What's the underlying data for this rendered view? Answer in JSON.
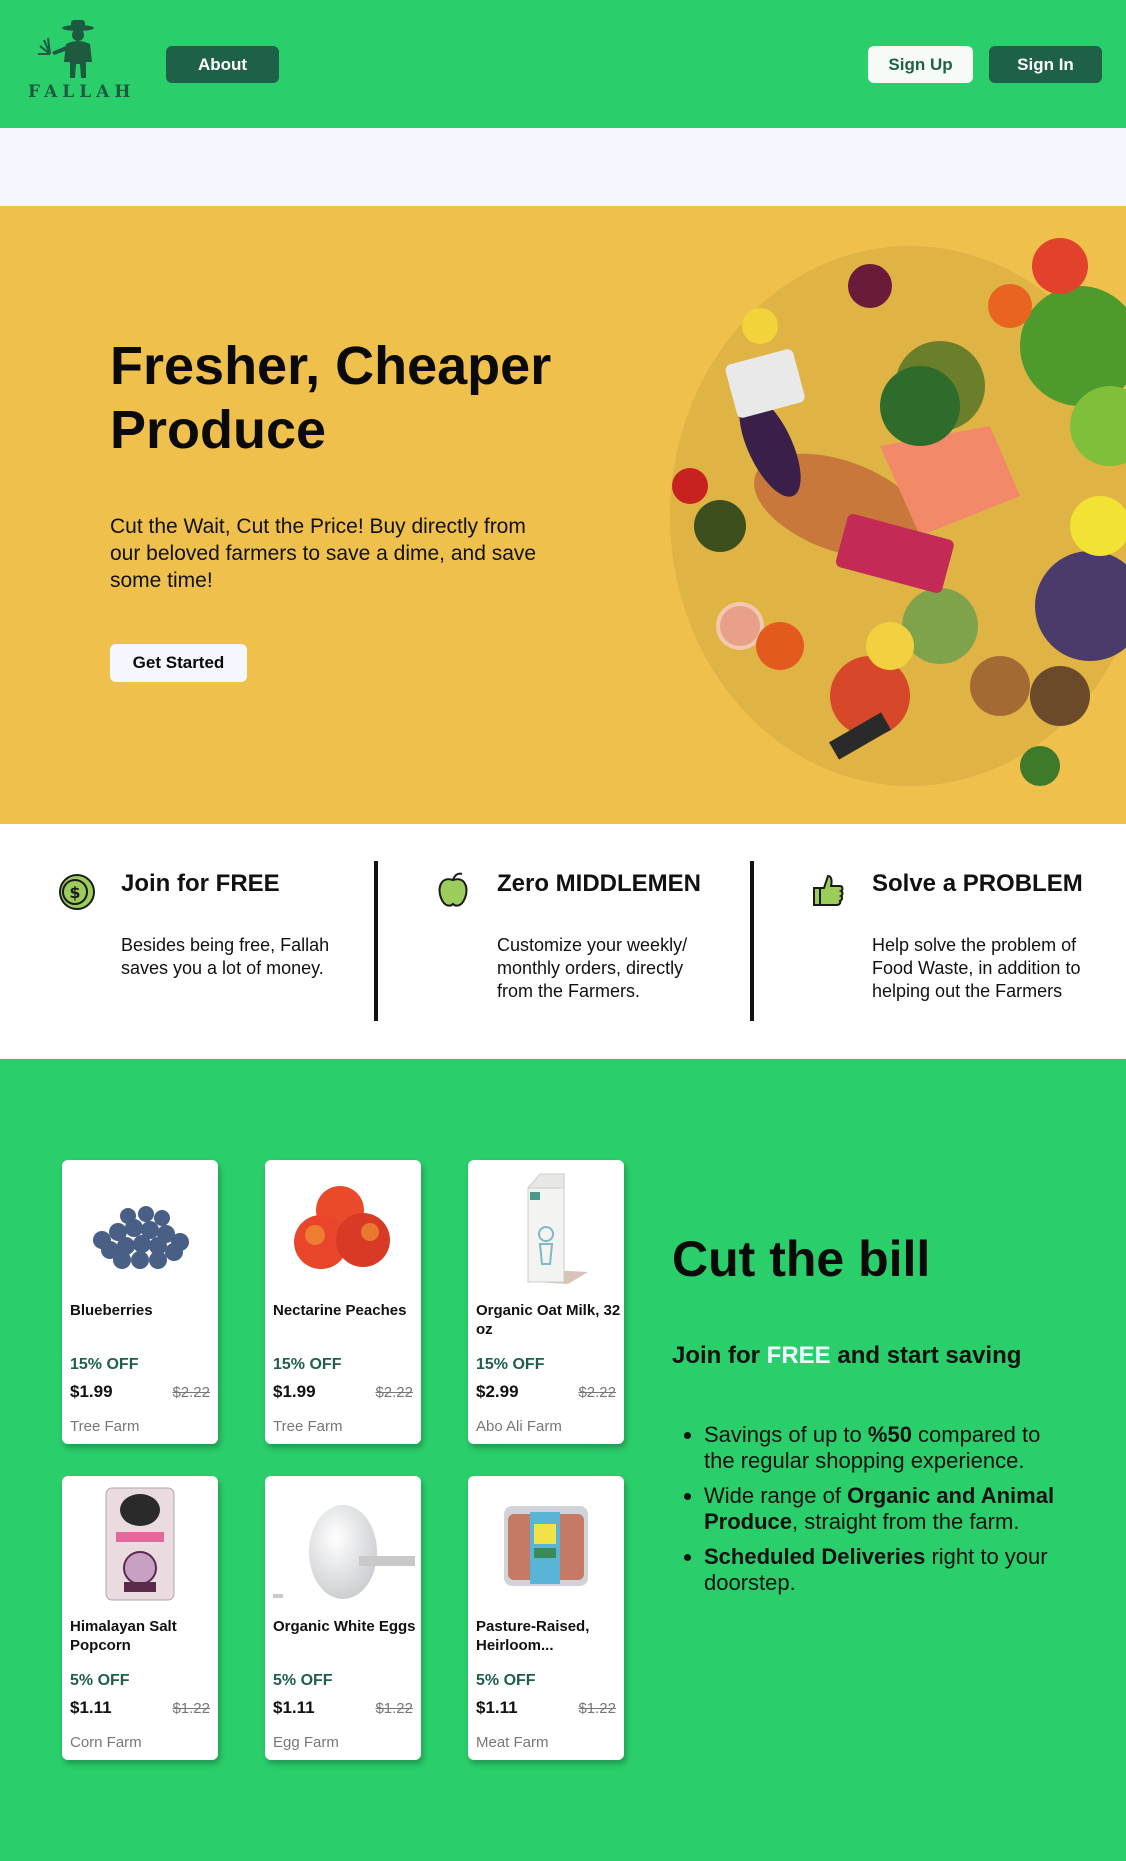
{
  "header": {
    "logo_text": "FALLAH",
    "about_label": "About",
    "signup_label": "Sign Up",
    "signin_label": "Sign In"
  },
  "hero": {
    "title": "Fresher, Cheaper Produce",
    "subtitle": "Cut the Wait, Cut the Price! Buy directly from our beloved farmers to save a dime, and save some time!",
    "cta_label": "Get Started"
  },
  "features": [
    {
      "icon": "dollar-coin-icon",
      "title": "Join for FREE",
      "text": "Besides being free, Fallah saves you a lot of money."
    },
    {
      "icon": "apple-icon",
      "title": "Zero MIDDLEMEN",
      "text": "Customize your weekly/ monthly orders, directly from the Farmers."
    },
    {
      "icon": "thumbs-up-icon",
      "title": "Solve a PROBLEM",
      "text": "Help solve the problem of Food Waste, in addition to helping out the Farmers"
    }
  ],
  "products": [
    {
      "name": "Blueberries",
      "discount": "15% OFF",
      "price": "$1.99",
      "old_price": "$2.22",
      "farm": "Tree Farm",
      "image": "blueberries"
    },
    {
      "name": "Nectarine Peaches",
      "discount": "15% OFF",
      "price": "$1.99",
      "old_price": "$2.22",
      "farm": "Tree Farm",
      "image": "peaches"
    },
    {
      "name": "Organic Oat Milk, 32 oz",
      "discount": "15% OFF",
      "price": "$2.99",
      "old_price": "$2.22",
      "farm": "Abo Ali Farm",
      "image": "oat-milk"
    },
    {
      "name": "Himalayan Salt Popcorn",
      "discount": "5% OFF",
      "price": "$1.11",
      "old_price": "$1.22",
      "farm": "Corn Farm",
      "image": "popcorn"
    },
    {
      "name": "Organic White Eggs",
      "discount": "5% OFF",
      "price": "$1.11",
      "old_price": "$1.22",
      "farm": "Egg Farm",
      "image": "egg"
    },
    {
      "name": "Pasture-Raised, Heirloom...",
      "discount": "5% OFF",
      "price": "$1.11",
      "old_price": "$1.22",
      "farm": "Meat Farm",
      "image": "meat"
    }
  ],
  "cut": {
    "title": "Cut the bill",
    "sub_before": "Join for ",
    "sub_free": "FREE",
    "sub_after": " and start saving",
    "bullets": [
      {
        "pre": "Savings of up to ",
        "bold": "%50",
        "post": " compared to the regular shopping experience."
      },
      {
        "pre": "Wide range of ",
        "bold": "Organic and Animal Produce",
        "post": ", straight from the farm."
      },
      {
        "pre": "",
        "bold": "Scheduled Deliveries",
        "post": " right to your doorstep."
      }
    ]
  },
  "colors": {
    "green": "#2ace6b",
    "dark_green": "#1f6148",
    "yellow": "#efc04c",
    "off_white": "#f4f8fe"
  }
}
